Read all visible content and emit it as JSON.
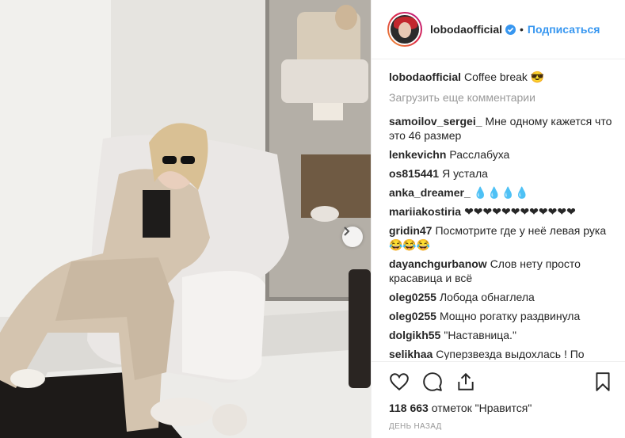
{
  "header": {
    "username": "lobodaofficial",
    "separator": "•",
    "follow_label": "Подписаться"
  },
  "caption": {
    "user": "lobodaofficial",
    "text": "Coffee break 😎"
  },
  "load_more_label": "Загрузить еще комментарии",
  "comments": [
    {
      "user": "samoilov_sergei_",
      "text": "Мне одному кажется что это 46 размер"
    },
    {
      "user": "lenkevichn",
      "text": "Расслабуха"
    },
    {
      "user": "os815441",
      "text": "Я устала"
    },
    {
      "user": "anka_dreamer_",
      "text": "💧💧💧💧"
    },
    {
      "user": "mariiakostiria",
      "text": "❤❤❤❤❤❤❤❤❤❤❤❤"
    },
    {
      "user": "gridin47",
      "text": "Посмотрите где у неё левая рука 😂😂😂"
    },
    {
      "user": "dayanchgurbanow",
      "text": "Слов нету просто красавица и всё"
    },
    {
      "user": "oleg0255",
      "text": "Лобода обнаглела"
    },
    {
      "user": "oleg0255",
      "text": "Мощно рогатку раздвинула"
    },
    {
      "user": "dolgikh55",
      "text": "\"Наставница.\""
    },
    {
      "user": "selikhaa",
      "text": "Суперзвезда выдохлась ! По"
    }
  ],
  "likes": {
    "count": "118 663",
    "text": "отметок \"Нравится\""
  },
  "time_label": "день назад",
  "icons": {
    "like": "heart-icon",
    "comment": "comment-icon",
    "share": "share-icon",
    "save": "bookmark-icon",
    "verified": "verified-badge-icon",
    "next": "chevron-right-icon"
  },
  "colors": {
    "accent": "#3897f0",
    "text": "#262626",
    "muted": "#999999",
    "border": "#efefef"
  }
}
